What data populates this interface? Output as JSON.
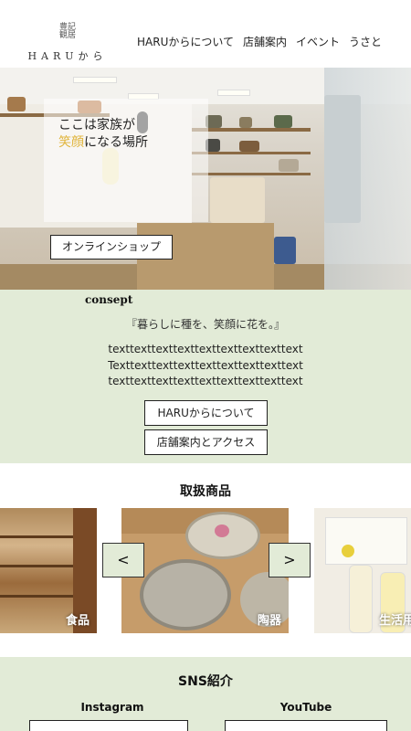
{
  "header": {
    "logo_mark": "HARUから",
    "logo_kanji": [
      "豊記",
      "観居"
    ],
    "logo_text": "HARUから",
    "nav": [
      "HARUからについて",
      "店舗案内",
      "イベント",
      "うさと"
    ]
  },
  "hero": {
    "copy_line1": "ここは家族が",
    "copy_accent": "笑顔",
    "copy_line2_rest": "になる場所",
    "online_button": "オンラインショップ"
  },
  "concept": {
    "title": "consept",
    "lead": "『暮らしに種を、笑顔に花を。』",
    "body": [
      "texttexttexttexttexttexttexttexttext",
      "Texttexttexttexttexttexttexttexttext",
      "texttexttexttexttexttexttexttexttext"
    ],
    "about_button": "HARUからについて",
    "access_button": "店舗案内とアクセス"
  },
  "products": {
    "title": "取扱商品",
    "slides": [
      "食品",
      "陶器",
      "生活用"
    ],
    "prev_label": "<",
    "next_label": ">"
  },
  "sns": {
    "title": "SNS紹介",
    "instagram": "Instagram",
    "youtube": "YouTube"
  },
  "colors": {
    "accent_green": "#e2ebd7",
    "accent_gold": "#e0b43a"
  }
}
